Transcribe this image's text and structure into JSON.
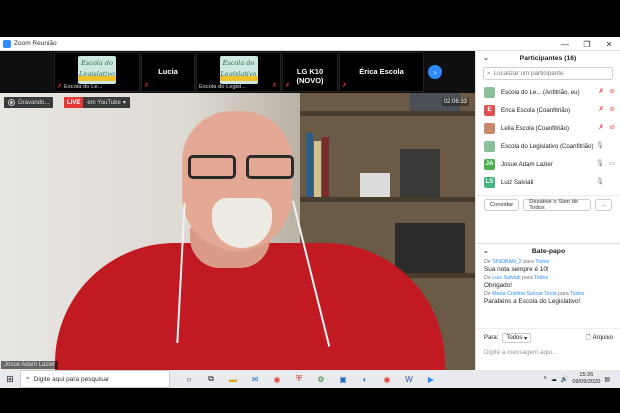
{
  "window": {
    "title": "Zoom Reunião",
    "controls": [
      "—",
      "❐",
      "✕"
    ]
  },
  "strip": {
    "tiles": [
      {
        "type": "logo",
        "logo_line1": "Escola do",
        "logo_line2": "Legislativo",
        "caption": "Escola do Le..."
      },
      {
        "type": "name",
        "name": "Lucia"
      },
      {
        "type": "logo",
        "logo_line1": "Escola do",
        "logo_line2": "Legislativo",
        "caption": "Escola do Legisl..."
      },
      {
        "type": "name",
        "name": "LG K10 (NOVO)"
      },
      {
        "type": "name",
        "name": "Érica Escola"
      }
    ]
  },
  "recording": {
    "label": "Gravando..."
  },
  "live": {
    "badge": "LIVE",
    "platform": "em YouTube"
  },
  "timer": "02:06:33",
  "speaker": {
    "name": "Josue Adam Lazier"
  },
  "participants": {
    "title": "Participantes (16)",
    "search_placeholder": "Localizar um participante",
    "items": [
      {
        "initial": "",
        "avatar_color": "#8bbf9a",
        "name": "Escola do Le...",
        "role": "(Anfitrião, eu)"
      },
      {
        "initial": "E",
        "avatar_color": "#e0524f",
        "name": "Érica Escola",
        "role": "(Coanfitrião)"
      },
      {
        "initial": "",
        "avatar_color": "#c9896b",
        "name": "Leila Escola",
        "role": "(Coanfitrião)"
      },
      {
        "initial": "",
        "avatar_color": "#8bbf9a",
        "name": "Escola do Legislativo",
        "role": "(Coanfitrião)"
      },
      {
        "initial": "JA",
        "avatar_color": "#4caf50",
        "name": "Josue Adam Lazier",
        "role": ""
      },
      {
        "initial": "LS",
        "avatar_color": "#43b581",
        "name": "Luiz Salviati",
        "role": ""
      }
    ],
    "buttons": {
      "invite": "Convidar",
      "mute_all": "Desative o Som de Todos",
      "more": "..."
    }
  },
  "chat": {
    "title": "Bate-papo",
    "messages": [
      {
        "from": "SINDBAN_2",
        "to": "Todos",
        "text": "Sua nota sempre é 10!"
      },
      {
        "from": "Luiz Salviati",
        "to": "Todos",
        "text": "Obrigado!"
      },
      {
        "from": "Maria Cristina Succar Tecla",
        "to": "Todos",
        "text": "Parabéns a Escola do Legislativo!"
      }
    ],
    "prefix_from": "De",
    "prefix_to": "para",
    "to_label": "Para:",
    "to_value": "Todos",
    "file_label": "Arquivo",
    "input_placeholder": "Digite a mensagem aqui..."
  },
  "taskbar": {
    "search_placeholder": "Digite aqui para pesquisar",
    "time": "15:26",
    "date": "09/09/2020"
  }
}
